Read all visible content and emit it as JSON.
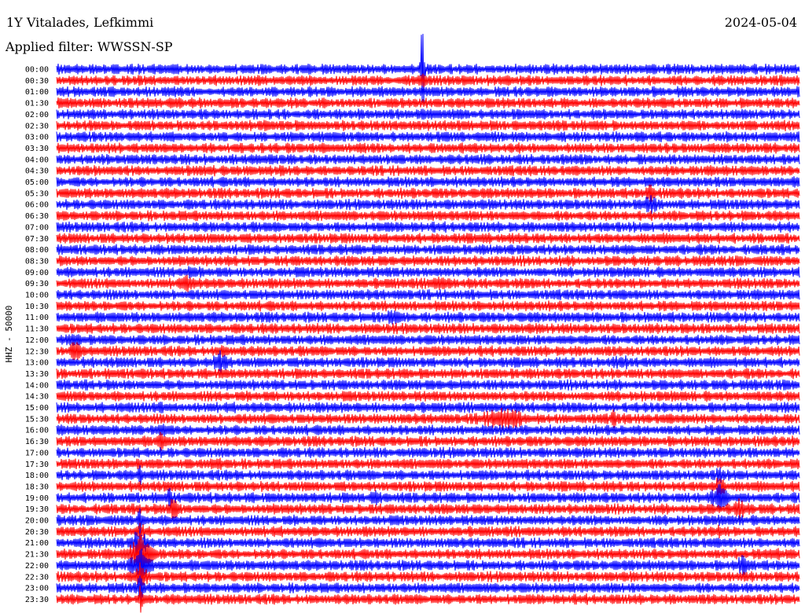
{
  "header": {
    "station": "1Y Vitalades, Lefkimmi",
    "date": "2024-05-04",
    "filter": "Applied filter: WWSSN-SP"
  },
  "chart_data": {
    "type": "line",
    "title": "1Y Vitalades, Lefkimmi",
    "ylabel": "HHZ - 50000",
    "row_labels": [
      "00:00",
      "00:30",
      "01:00",
      "01:30",
      "02:00",
      "02:30",
      "03:00",
      "03:30",
      "04:00",
      "04:30",
      "05:00",
      "05:30",
      "06:00",
      "06:30",
      "07:00",
      "07:30",
      "08:00",
      "08:30",
      "09:00",
      "09:30",
      "10:00",
      "10:30",
      "11:00",
      "11:30",
      "12:00",
      "12:30",
      "13:00",
      "13:30",
      "14:00",
      "14:30",
      "15:00",
      "15:30",
      "16:00",
      "16:30",
      "17:00",
      "17:30",
      "18:00",
      "18:30",
      "19:00",
      "19:30",
      "20:00",
      "20:30",
      "21:00",
      "21:30",
      "22:00",
      "22:30",
      "23:00",
      "23:30"
    ],
    "series_colors": [
      "#0000ff",
      "#ff0000"
    ]
  }
}
